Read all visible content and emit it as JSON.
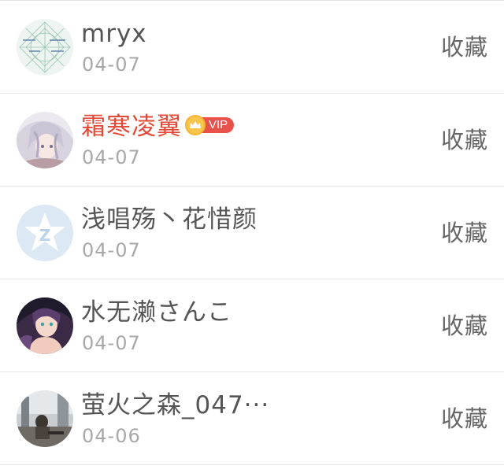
{
  "favorites": [
    {
      "name": "mryx",
      "date": "04-07",
      "action_label": "收藏",
      "vip": false,
      "avatar": "avatar-geometric-pattern"
    },
    {
      "name": "霜寒凌翼",
      "date": "04-07",
      "action_label": "收藏",
      "vip": true,
      "vip_label": "VIP",
      "avatar": "avatar-anime-girl"
    },
    {
      "name": "浅唱殇丶花惜颜",
      "date": "04-07",
      "action_label": "收藏",
      "vip": false,
      "avatar": "avatar-default-z-star"
    },
    {
      "name": "水无濑さんこ",
      "date": "04-07",
      "action_label": "收藏",
      "vip": false,
      "avatar": "avatar-anime-character"
    },
    {
      "name": "萤火之森_047···",
      "date": "04-06",
      "action_label": "收藏",
      "vip": false,
      "avatar": "avatar-street-photo"
    }
  ],
  "colors": {
    "name": "#555555",
    "vip_name": "#e24a36",
    "date": "#a8a8a8",
    "action": "#666666",
    "vip_tag": "#e9524a",
    "crown": "#f7c64a",
    "divider": "#e6e6e6"
  }
}
